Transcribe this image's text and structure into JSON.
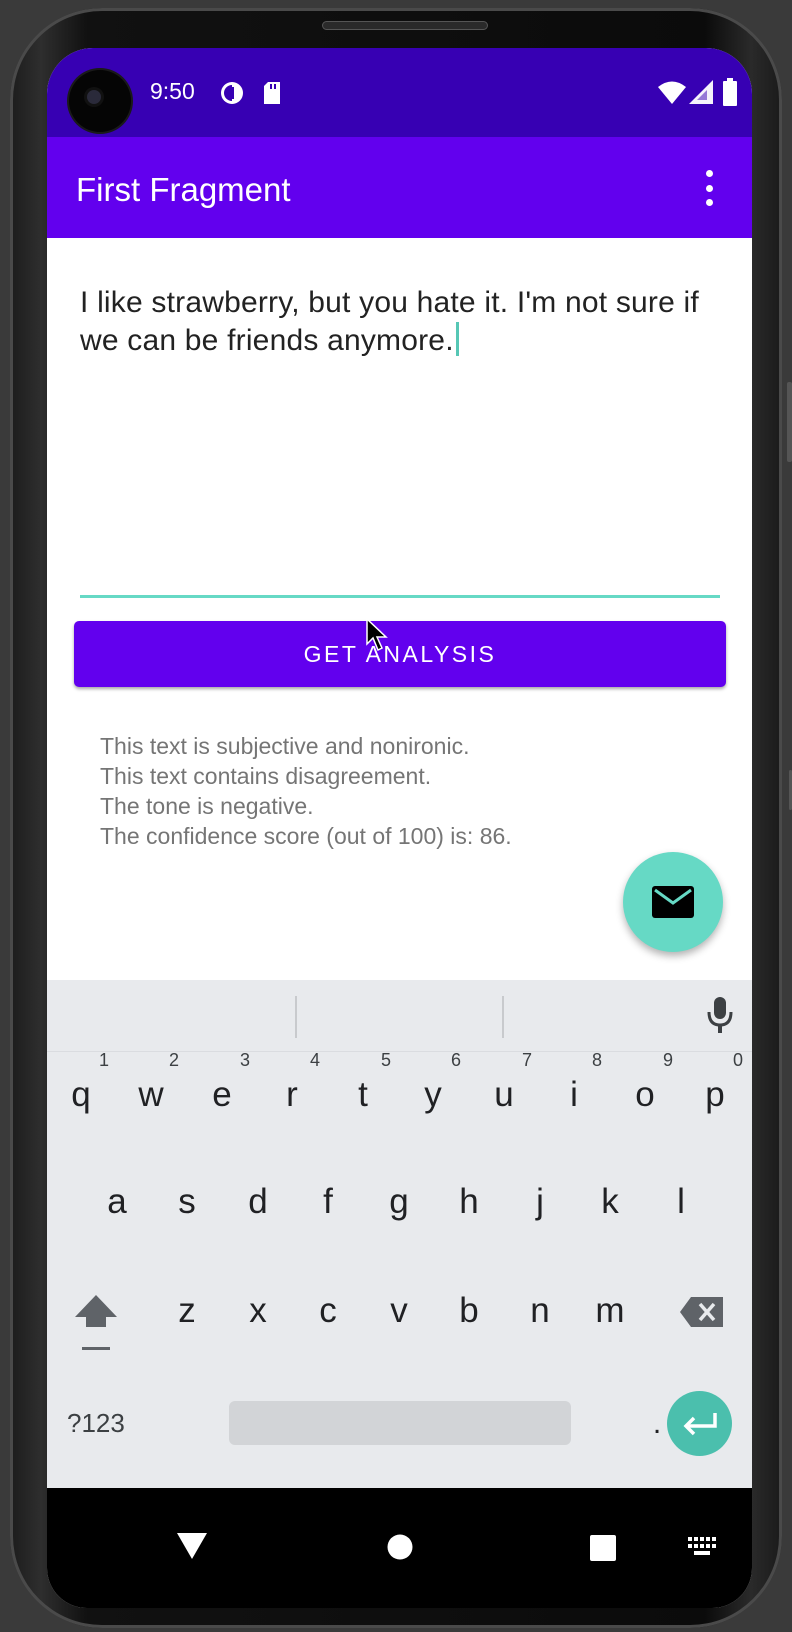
{
  "status_bar": {
    "time": "9:50"
  },
  "app_bar": {
    "title": "First Fragment"
  },
  "input": {
    "value": "I like strawberry, but you hate it. I'm not sure if we can be friends anymore."
  },
  "analyze_button": {
    "label": "GET ANALYSIS"
  },
  "results": {
    "lines": [
      "This text is subjective and nonironic.",
      "This text contains disagreement.",
      "The tone is negative.",
      "The confidence score (out of 100) is: 86."
    ]
  },
  "keyboard": {
    "row1": [
      {
        "key": "q",
        "hint": "1"
      },
      {
        "key": "w",
        "hint": "2"
      },
      {
        "key": "e",
        "hint": "3"
      },
      {
        "key": "r",
        "hint": "4"
      },
      {
        "key": "t",
        "hint": "5"
      },
      {
        "key": "y",
        "hint": "6"
      },
      {
        "key": "u",
        "hint": "7"
      },
      {
        "key": "i",
        "hint": "8"
      },
      {
        "key": "o",
        "hint": "9"
      },
      {
        "key": "p",
        "hint": "0"
      }
    ],
    "row2": [
      "a",
      "s",
      "d",
      "f",
      "g",
      "h",
      "j",
      "k",
      "l"
    ],
    "row3": [
      "z",
      "x",
      "c",
      "v",
      "b",
      "n",
      "m"
    ],
    "symbols_label": "?123",
    "comma": ",",
    "period": "."
  },
  "colors": {
    "status_bar": "#3700b3",
    "primary": "#6200ee",
    "accent": "#66d9c5",
    "result_text": "#757575",
    "keyboard_bg": "#e8eaed"
  },
  "icons": [
    "camera-icon",
    "data-saver-icon",
    "sd-card-icon",
    "wifi-icon",
    "signal-icon",
    "battery-icon",
    "overflow-menu-icon",
    "email-icon",
    "microphone-icon",
    "shift-icon",
    "backspace-icon",
    "enter-icon",
    "back-icon",
    "home-icon",
    "recents-icon",
    "keyboard-switch-icon"
  ]
}
